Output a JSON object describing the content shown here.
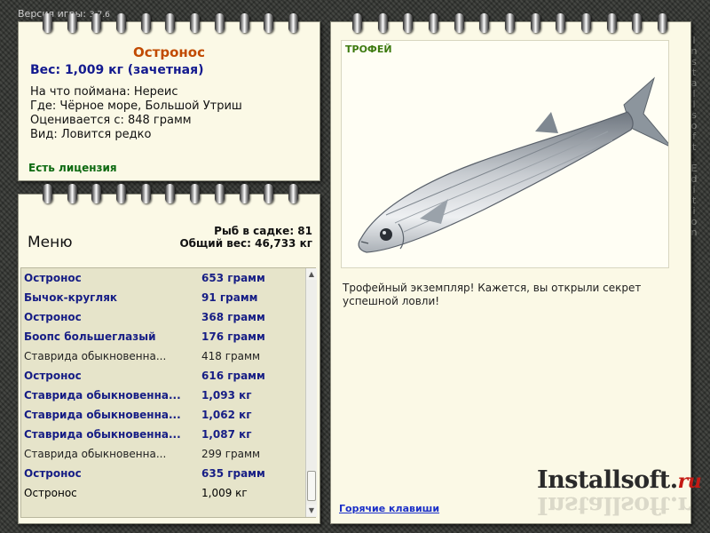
{
  "version": {
    "label": "Версия игры:",
    "number": "3.7.6"
  },
  "side_brand": "Installsoft Edition",
  "catch_info": {
    "fish_name": "Остронос",
    "weight_line": "Вес: 1,009 кг (зачетная)",
    "details": [
      "На что поймана: Нереис",
      "Где: Чёрное море, Большой Утриш",
      "Оценивается с: 848 грамм",
      "Вид: Ловится редко"
    ],
    "license": "Есть лицензия"
  },
  "menu": {
    "label": "Меню",
    "fish_count": "Рыб в садке: 81",
    "total_weight": "Общий вес: 46,733 кг"
  },
  "catch_list": [
    {
      "name": "Остронос",
      "weight": "653 грамм",
      "style": "bold"
    },
    {
      "name": "Бычок-кругляк",
      "weight": "91 грамм",
      "style": "bold"
    },
    {
      "name": "Остронос",
      "weight": "368 грамм",
      "style": "bold"
    },
    {
      "name": "Боопс большеглазый",
      "weight": "176 грамм",
      "style": "bold"
    },
    {
      "name": "Ставрида обыкновенна...",
      "weight": "418 грамм",
      "style": "plain"
    },
    {
      "name": "Остронос",
      "weight": "616 грамм",
      "style": "bold"
    },
    {
      "name": "Ставрида обыкновенна...",
      "weight": "1,093 кг",
      "style": "bold"
    },
    {
      "name": "Ставрида обыкновенна...",
      "weight": "1,062 кг",
      "style": "bold"
    },
    {
      "name": "Ставрида обыкновенна...",
      "weight": "1,087 кг",
      "style": "bold"
    },
    {
      "name": "Ставрида обыкновенна...",
      "weight": "299 грамм",
      "style": "plain"
    },
    {
      "name": "Остронос",
      "weight": "635 грамм",
      "style": "bold"
    },
    {
      "name": "Остронос",
      "weight": "1,009 кг",
      "style": "selected"
    }
  ],
  "trophy": {
    "label": "ТРОФЕЙ",
    "message": "Трофейный экземпляр! Кажется, вы открыли секрет успешной ловли!",
    "hotkeys_link": "Горячие клавиши"
  },
  "watermark": {
    "main": "Installsoft.",
    "suffix": "ru"
  },
  "colors": {
    "title_orange": "#c14a00",
    "weight_blue": "#131a8f",
    "license_green": "#0d6a11",
    "trophy_green": "#3d7a0f",
    "selection_blue": "#2e8ff2",
    "paper": "#fbf9e6",
    "link_blue": "#1b30c8"
  },
  "icons": [
    "spiral-ring",
    "scroll-up-arrow",
    "scroll-down-arrow",
    "fish-photo"
  ]
}
